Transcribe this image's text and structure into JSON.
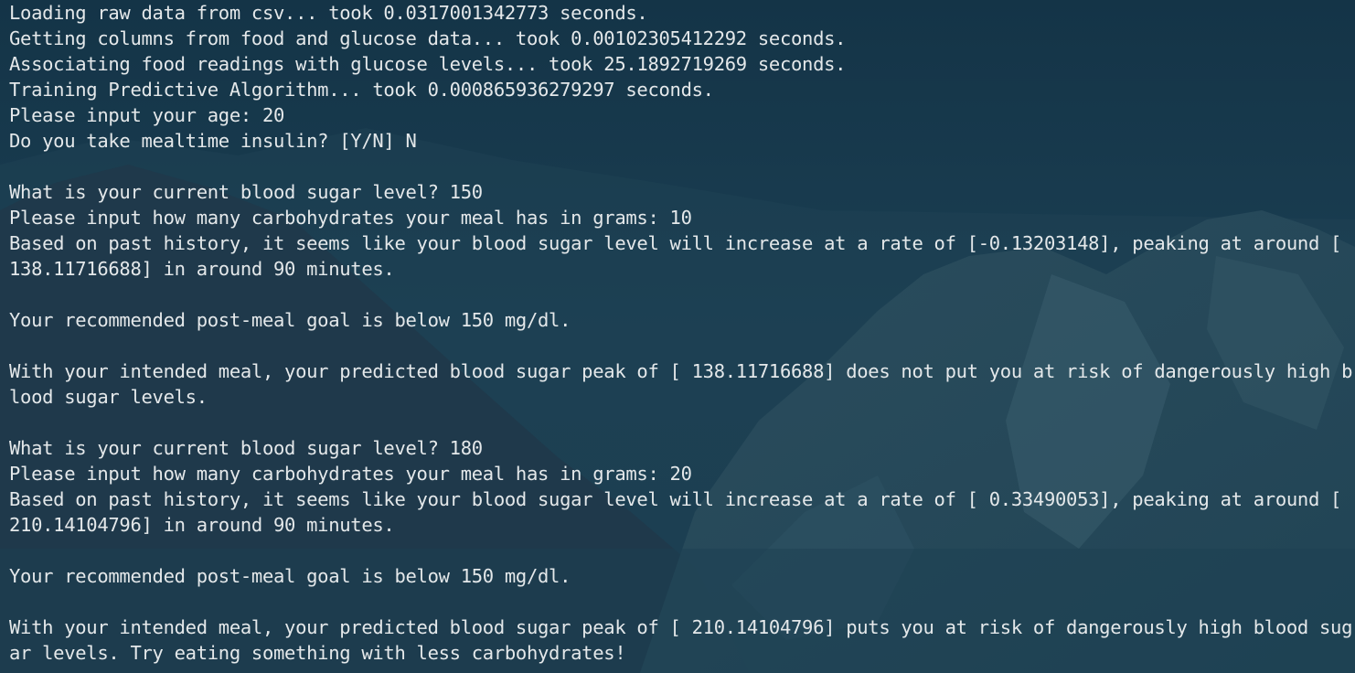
{
  "terminal": {
    "lines": [
      "Loading raw data from csv... took 0.0317001342773 seconds.",
      "Getting columns from food and glucose data... took 0.00102305412292 seconds.",
      "Associating food readings with glucose levels... took 25.1892719269 seconds.",
      "Training Predictive Algorithm... took 0.000865936279297 seconds.",
      "Please input your age: 20",
      "Do you take mealtime insulin? [Y/N] N",
      "",
      "What is your current blood sugar level? 150",
      "Please input how many carbohydrates your meal has in grams: 10",
      "Based on past history, it seems like your blood sugar level will increase at a rate of [-0.13203148], peaking at around [",
      "138.11716688] in around 90 minutes.",
      "",
      "Your recommended post-meal goal is below 150 mg/dl.",
      "",
      "With your intended meal, your predicted blood sugar peak of [ 138.11716688] does not put you at risk of dangerously high b",
      "lood sugar levels.",
      "",
      "What is your current blood sugar level? 180",
      "Please input how many carbohydrates your meal has in grams: 20",
      "Based on past history, it seems like your blood sugar level will increase at a rate of [ 0.33490053], peaking at around [",
      "210.14104796] in around 90 minutes.",
      "",
      "Your recommended post-meal goal is below 150 mg/dl.",
      "",
      "With your intended meal, your predicted blood sugar peak of [ 210.14104796] puts you at risk of dangerously high blood sug",
      "ar levels. Try eating something with less carbohydrates!"
    ]
  }
}
